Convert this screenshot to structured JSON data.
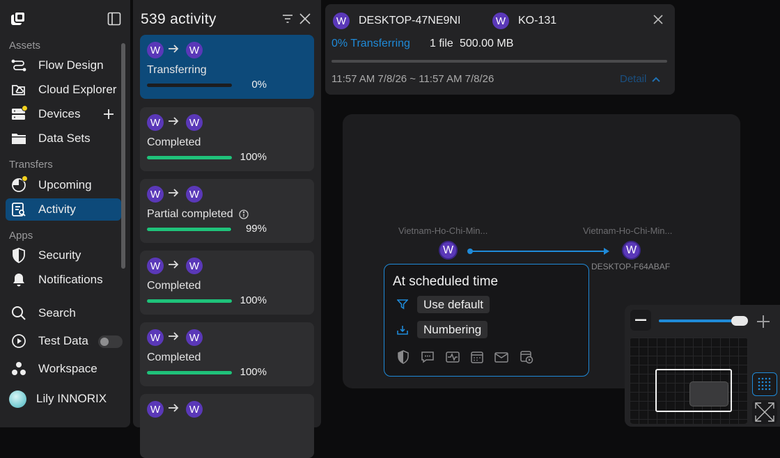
{
  "sidebar": {
    "sections": {
      "assets": "Assets",
      "transfers": "Transfers",
      "apps": "Apps"
    },
    "items": {
      "flow_design": "Flow Design",
      "cloud_explorer": "Cloud Explorer",
      "devices": "Devices",
      "data_sets": "Data Sets",
      "upcoming": "Upcoming",
      "activity": "Activity",
      "security": "Security",
      "notifications": "Notifications",
      "search": "Search",
      "test_data": "Test Data",
      "workspace": "Workspace",
      "user": "Lily INNORIX"
    },
    "test_data_toggle": false,
    "active_item": "activity"
  },
  "activity_panel": {
    "count": "539",
    "title": "activity",
    "cards": [
      {
        "from": "W",
        "to": "W",
        "status": "Transferring",
        "percent": "0%",
        "progress": 0,
        "active": true,
        "info": false
      },
      {
        "from": "W",
        "to": "W",
        "status": "Completed",
        "percent": "100%",
        "progress": 100,
        "active": false,
        "info": false
      },
      {
        "from": "W",
        "to": "W",
        "status": "Partial completed",
        "percent": "99%",
        "progress": 99,
        "active": false,
        "info": true
      },
      {
        "from": "W",
        "to": "W",
        "status": "Completed",
        "percent": "100%",
        "progress": 100,
        "active": false,
        "info": false
      },
      {
        "from": "W",
        "to": "W",
        "status": "Completed",
        "percent": "100%",
        "progress": 100,
        "active": false,
        "info": false
      },
      {
        "from": "W",
        "to": "W",
        "status": "",
        "percent": "",
        "progress": null,
        "active": false,
        "info": false
      }
    ]
  },
  "detail": {
    "source_badge": "W",
    "source_name": "DESKTOP-47NE9NI",
    "target_badge": "W",
    "target_name": "KO-131",
    "progress_text": "0% Transferring",
    "file_count": "1 file",
    "size": "500.00 MB",
    "progress": 0,
    "time_range": "11:57 AM 7/8/26 ~ 11:57 AM 7/8/26",
    "detail_link": "Detail"
  },
  "canvas": {
    "source": {
      "badge": "W",
      "label": "Vietnam-Ho-Chi-Min..."
    },
    "target": {
      "badge": "W",
      "label": "Vietnam-Ho-Chi-Min...",
      "name": "DESKTOP-F64ABAF"
    },
    "popup": {
      "title": "At scheduled time",
      "option1": "Use default",
      "option2": "Numbering",
      "toolbar_icons": [
        "shield-icon",
        "comment-icon",
        "pulse-icon",
        "calendar-icon",
        "mail-icon",
        "schedule-icon"
      ]
    }
  },
  "minimap": {
    "zoom_level": 0.93
  },
  "colors": {
    "accent": "#1f8ad8",
    "active_bg": "#0d4a7a",
    "success": "#1fc27a",
    "badge": "#5a38b8",
    "warning_dot": "#f5d21f"
  }
}
